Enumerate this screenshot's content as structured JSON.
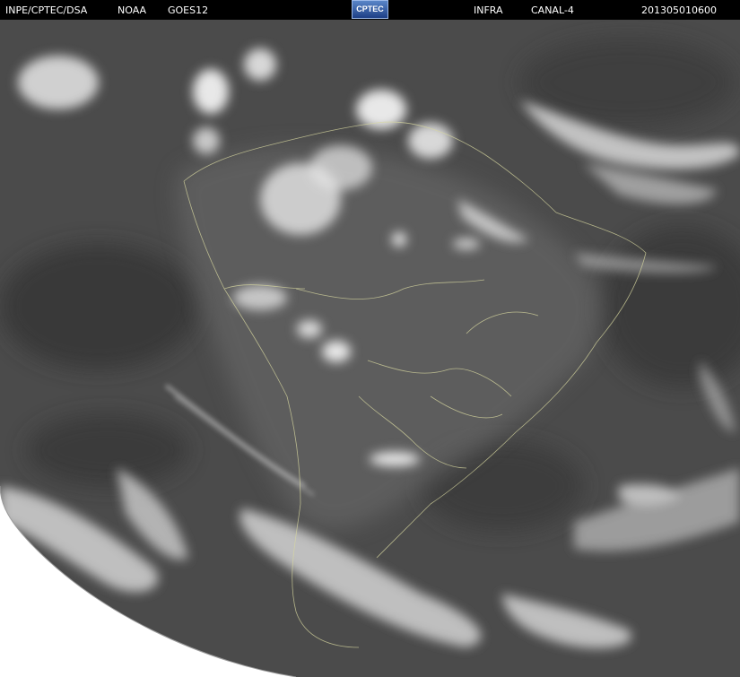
{
  "header": {
    "agency": "INPE/CPTEC/DSA",
    "provider": "NOAA",
    "satellite": "GOES12",
    "logo_text": "CPTEC",
    "band": "INFRA",
    "channel": "CANAL-4",
    "timestamp": "201305010600"
  },
  "image": {
    "description_icon": "satellite-earth-disk",
    "space_color": "#ffffff",
    "earth_base_color": "#4a4a4a",
    "cloud_color": "#e6e6e6",
    "border_color": "#d8d8a0"
  }
}
